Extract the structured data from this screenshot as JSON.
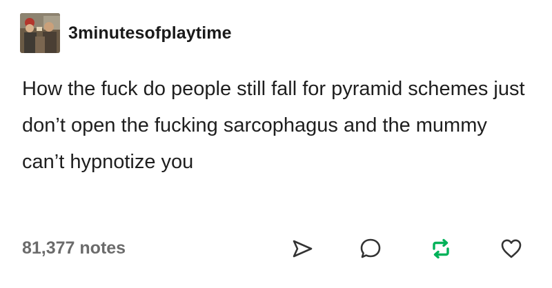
{
  "post": {
    "username": "3minutesofplaytime",
    "text": "How the fuck do people still fall for pyramid schemes just don’t open the fucking sarcophagus and the mummy can’t hypnotize you",
    "notes": "81,377 notes"
  },
  "actions": {
    "share_icon": "paper-plane-icon",
    "reply_icon": "speech-bubble-icon",
    "reblog_icon": "reblog-arrows-icon",
    "like_icon": "heart-icon"
  },
  "colors": {
    "text": "#1e1e1e",
    "notes": "#6b6b6b",
    "reblog": "#00b259",
    "icon": "#333333"
  }
}
